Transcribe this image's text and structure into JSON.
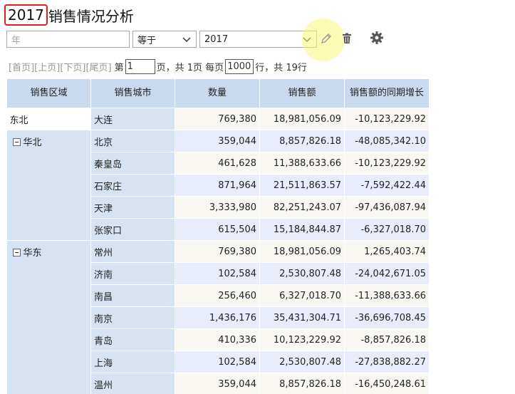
{
  "title": {
    "year": "2017",
    "rest": "销售情况分析"
  },
  "filters": {
    "field_placeholder": "年",
    "operator": "等于",
    "value": "2017"
  },
  "icons": {
    "edit": "pencil-icon",
    "delete": "trash-icon",
    "settings": "gear-icon"
  },
  "pager": {
    "first": "[首页]",
    "prev": "[上页]",
    "next": "[下页]",
    "last": "[尾页]",
    "page_prefix": "第",
    "page_value": "1",
    "page_suffix": "页，共 1页 每页",
    "rows_value": "1000",
    "rows_suffix": "行，共 19行"
  },
  "table": {
    "headers": [
      "销售区域",
      "销售城市",
      "数量",
      "销售额",
      "销售额的同期增长"
    ],
    "groups": [
      {
        "region": "东北",
        "collapsible": false,
        "rows": [
          {
            "city": "大连",
            "qty": "769,380",
            "sales": "18,981,056.09",
            "growth": "-10,123,229.92"
          }
        ]
      },
      {
        "region": "华北",
        "collapsible": true,
        "rows": [
          {
            "city": "北京",
            "qty": "359,044",
            "sales": "8,857,826.18",
            "growth": "-48,085,342.10"
          },
          {
            "city": "秦皇岛",
            "qty": "461,628",
            "sales": "11,388,633.66",
            "growth": "-10,123,229.92"
          },
          {
            "city": "石家庄",
            "qty": "871,964",
            "sales": "21,511,863.57",
            "growth": "-7,592,422.44"
          },
          {
            "city": "天津",
            "qty": "3,333,980",
            "sales": "82,251,243.07",
            "growth": "-97,436,087.94"
          },
          {
            "city": "张家口",
            "qty": "615,504",
            "sales": "15,184,844.87",
            "growth": "-6,327,018.70"
          }
        ]
      },
      {
        "region": "华东",
        "collapsible": true,
        "rows": [
          {
            "city": "常州",
            "qty": "769,380",
            "sales": "18,981,056.09",
            "growth": "1,265,403.74"
          },
          {
            "city": "济南",
            "qty": "102,584",
            "sales": "2,530,807.48",
            "growth": "-24,042,671.05"
          },
          {
            "city": "南昌",
            "qty": "256,460",
            "sales": "6,327,018.70",
            "growth": "-11,388,633.66"
          },
          {
            "city": "南京",
            "qty": "1,436,176",
            "sales": "35,431,304.71",
            "growth": "-36,696,708.45"
          },
          {
            "city": "青岛",
            "qty": "410,336",
            "sales": "10,123,229.92",
            "growth": "-8,857,826.18"
          },
          {
            "city": "上海",
            "qty": "102,584",
            "sales": "2,530,807.48",
            "growth": "-27,838,882.27"
          },
          {
            "city": "温州",
            "qty": "359,044",
            "sales": "8,857,826.18",
            "growth": "-16,450,248.61"
          }
        ]
      }
    ]
  }
}
